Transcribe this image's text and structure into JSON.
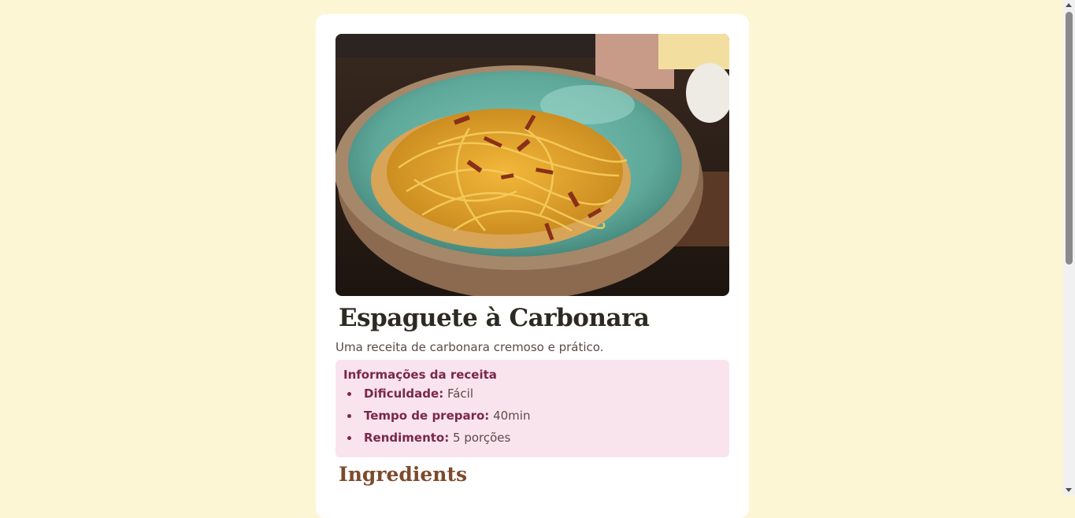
{
  "recipe": {
    "image_alt": "Espaguete à Carbonara",
    "title": "Espaguete à Carbonara",
    "description": "Uma receita de carbonara cremoso e prático.",
    "info": {
      "heading": "Informações da receita",
      "items": [
        {
          "label": "Dificuldade:",
          "value": "Fácil"
        },
        {
          "label": "Tempo de preparo:",
          "value": "40min"
        },
        {
          "label": "Rendimento:",
          "value": "5 porções"
        }
      ]
    },
    "ingredients_heading": "Ingredients"
  },
  "colors": {
    "page_bg": "#fdf6d5",
    "card_bg": "#ffffff",
    "info_bg": "#f9e4ee",
    "accent_rose": "#7a2748",
    "heading_brown": "#7d4a2c",
    "text": "#5a4a48"
  },
  "icons": {
    "scroll_up": "chevron-up-icon",
    "scroll_down": "chevron-down-icon"
  }
}
